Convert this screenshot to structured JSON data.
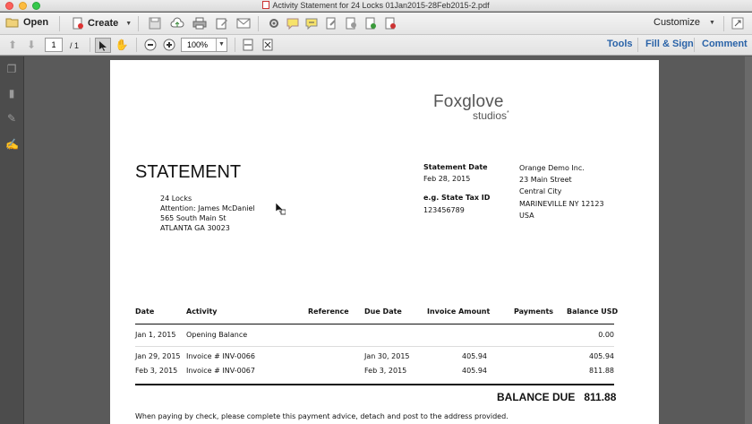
{
  "window": {
    "title": "Activity Statement for 24 Locks 01Jan2015-28Feb2015-2.pdf"
  },
  "toolbar": {
    "open_label": "Open",
    "create_label": "Create",
    "customize_label": "Customize"
  },
  "nav": {
    "page_current": "1",
    "page_total": "/ 1",
    "zoom": "100%",
    "tools": "Tools",
    "fill_sign": "Fill & Sign",
    "comment": "Comment"
  },
  "doc": {
    "logo_main": "Foxglove",
    "logo_sub": "studios",
    "logo_mark": "*",
    "heading": "STATEMENT",
    "to_lines": [
      "24 Locks",
      "Attention: James McDaniel",
      "565 South Main St",
      "ATLANTA GA 30023"
    ],
    "statement_date_label": "Statement Date",
    "statement_date": "Feb 28, 2015",
    "tax_label": "e.g. State Tax ID",
    "tax_id": "123456789",
    "from_lines": [
      "Orange Demo Inc.",
      "23 Main Street",
      "Central City",
      "MARINEVILLE NY 12123",
      "USA"
    ],
    "table_headers": [
      "Date",
      "Activity",
      "Reference",
      "Due Date",
      "Invoice Amount",
      "Payments",
      "Balance USD"
    ],
    "rows": [
      [
        "Jan 1, 2015",
        "Opening Balance",
        "",
        "",
        "",
        "",
        "0.00"
      ],
      [
        "Jan 29, 2015",
        "Invoice # INV-0066",
        "",
        "Jan 30, 2015",
        "405.94",
        "",
        "405.94"
      ],
      [
        "Feb 3, 2015",
        "Invoice # INV-0067",
        "",
        "Feb 3, 2015",
        "405.94",
        "",
        "811.88"
      ]
    ],
    "balance_due_label": "BALANCE DUE",
    "balance_due_value": "811.88",
    "footer_note": "When paying by check, please complete this payment advice, detach and post to the address provided."
  },
  "colors": {
    "accent_link": "#2a63a8",
    "logo_green": "#6a9a2a",
    "close": "#fc605b",
    "minimize": "#fdbc40",
    "zoom": "#34c84a"
  },
  "icons": [
    "folder-icon",
    "create-pdf-icon",
    "save-icon",
    "cloud-upload-icon",
    "print-icon",
    "edit-icon",
    "mail-icon",
    "settings-icon",
    "comment-icon",
    "highlight-icon",
    "stamp-icon",
    "sign-icon",
    "fullscreen-icon",
    "page-up-icon",
    "page-down-icon",
    "select-arrow-icon",
    "hand-icon",
    "zoom-out-icon",
    "zoom-in-icon",
    "fit-width-icon",
    "fit-page-icon",
    "thumbnails-icon",
    "bookmarks-icon",
    "attachment-icon",
    "signature-pen-icon"
  ]
}
